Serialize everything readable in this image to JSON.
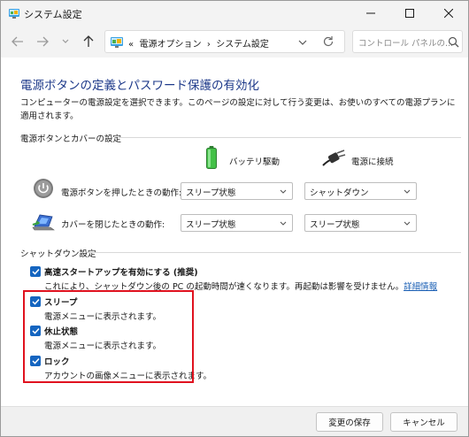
{
  "window": {
    "title": "システム設定"
  },
  "nav": {
    "breadcrumb_sep": "«",
    "crumb1": "電源オプション",
    "crumb_arrow": "›",
    "crumb2": "システム設定",
    "search_placeholder": "コントロール パネルの..."
  },
  "page": {
    "title": "電源ボタンの定義とパスワード保護の有効化",
    "description": "コンピューターの電源設定を選択できます。このページの設定に対して行う変更は、お使いのすべての電源プランに適用されます。"
  },
  "power_section": {
    "label": "電源ボタンとカバーの設定",
    "battery_label": "バッテリ駆動",
    "plugged_label": "電源に接続",
    "rows": [
      {
        "label": "電源ボタンを押したときの動作:",
        "battery": "スリープ状態",
        "plugged": "シャットダウン"
      },
      {
        "label": "カバーを閉じたときの動作:",
        "battery": "スリープ状態",
        "plugged": "スリープ状態"
      }
    ]
  },
  "shutdown_section": {
    "label": "シャットダウン設定",
    "fast_startup": {
      "title": "高速スタートアップを有効にする (推奨)",
      "desc": "これにより、シャットダウン後の PC の起動時間が速くなります。再起動は影響を受けません。",
      "link": "詳細情報"
    },
    "sleep": {
      "title": "スリープ",
      "desc": "電源メニューに表示されます。"
    },
    "hibernate": {
      "title": "休止状態",
      "desc": "電源メニューに表示されます。"
    },
    "lock": {
      "title": "ロック",
      "desc": "アカウントの画像メニューに表示されます。"
    }
  },
  "footer": {
    "save": "変更の保存",
    "cancel": "キャンセル"
  },
  "colors": {
    "accent": "#1565c0",
    "title_blue": "#1e3a8a",
    "highlight_red": "#e0121f"
  }
}
